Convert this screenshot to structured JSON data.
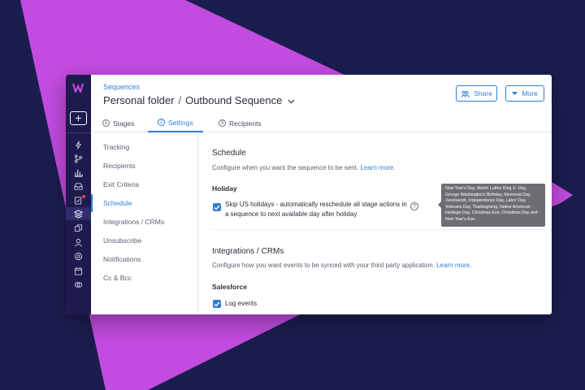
{
  "colors": {
    "background": "#1c1d4f",
    "accent_shape": "#c34ce0",
    "rail": "#1d1b4d",
    "link": "#2f7dd6"
  },
  "header": {
    "breadcrumb": "Sequences",
    "folder": "Personal folder",
    "separator": "/",
    "sequence_name": "Outbound Sequence",
    "share_label": "Share",
    "more_label": "More"
  },
  "tabs": [
    {
      "num": "1",
      "label": "Stages"
    },
    {
      "num": "2",
      "label": "Settings",
      "active": true
    },
    {
      "num": "3",
      "label": "Recipients"
    }
  ],
  "side_menu": [
    {
      "label": "Tracking"
    },
    {
      "label": "Recipients"
    },
    {
      "label": "Exit Criteria"
    },
    {
      "label": "Schedule",
      "active": true
    },
    {
      "label": "Integrations / CRMs"
    },
    {
      "label": "Unsubscribe"
    },
    {
      "label": "Notifications"
    },
    {
      "label": "Cc & Bcc"
    }
  ],
  "schedule": {
    "title": "Schedule",
    "description": "Configure when you want the sequence to be sent.",
    "learn_more": "Learn more.",
    "holiday_label": "Holiday",
    "holiday_checkbox": "Skip US holidays - automatically reschedule all stage actions in a sequence to next available day after holiday",
    "holiday_checked": true,
    "help_icon": "?"
  },
  "tooltip": "New Year's Day, Martin Luther King Jr. Day, George Washington's Birthday, Memorial Day, Juneteenth, Independence Day, Labor Day, Veterans Day, Thanksgiving, Native American Heritage Day, Christmas Eve, Christmas Day and New Year's Eve.",
  "integrations": {
    "title": "Integrations / CRMs",
    "description": "Configure how you want events to be synced with your third party application.",
    "learn_more": "Learn more.",
    "salesforce_label": "Salesforce",
    "log_events": "Log events",
    "log_events_checked": true
  },
  "rail_icons": [
    "bolt-icon",
    "branch-icon",
    "chart-icon",
    "inbox-icon",
    "tasks-icon",
    "sequences-icon",
    "copy-icon",
    "user-icon",
    "settings-icon",
    "calendar-icon",
    "link-icon"
  ]
}
